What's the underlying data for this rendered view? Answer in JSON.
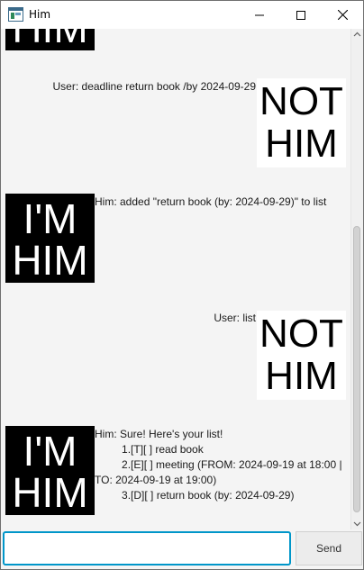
{
  "window": {
    "title": "Him",
    "icons": {
      "app": "app-window-icon",
      "minimize": "minimize-icon",
      "maximize": "maximize-icon",
      "close": "close-icon"
    }
  },
  "avatars": {
    "him": {
      "line1": "I'M",
      "line2": "HIM"
    },
    "user": {
      "line1": "NOT",
      "line2": "HIM"
    }
  },
  "messages": [
    {
      "sender": "him",
      "text": ""
    },
    {
      "sender": "user",
      "text": "User: deadline return book /by 2024-09-29"
    },
    {
      "sender": "him",
      "text": "Him: added \"return book (by: 2024-09-29)\" to list"
    },
    {
      "sender": "user",
      "text": "User: list"
    },
    {
      "sender": "him",
      "text": "Him: Sure! Here's your list!\n         1.[T][ ] read book\n         2.[E][ ] meeting (FROM: 2024-09-19 at 18:00 |\nTO: 2024-09-19 at 19:00)\n         3.[D][ ] return book (by: 2024-09-29)"
    }
  ],
  "input": {
    "value": "",
    "placeholder": ""
  },
  "send_button": {
    "label": "Send"
  },
  "colors": {
    "input_focus": "#0096c9",
    "avatar_him_bg": "#000000",
    "avatar_user_bg": "#ffffff"
  }
}
